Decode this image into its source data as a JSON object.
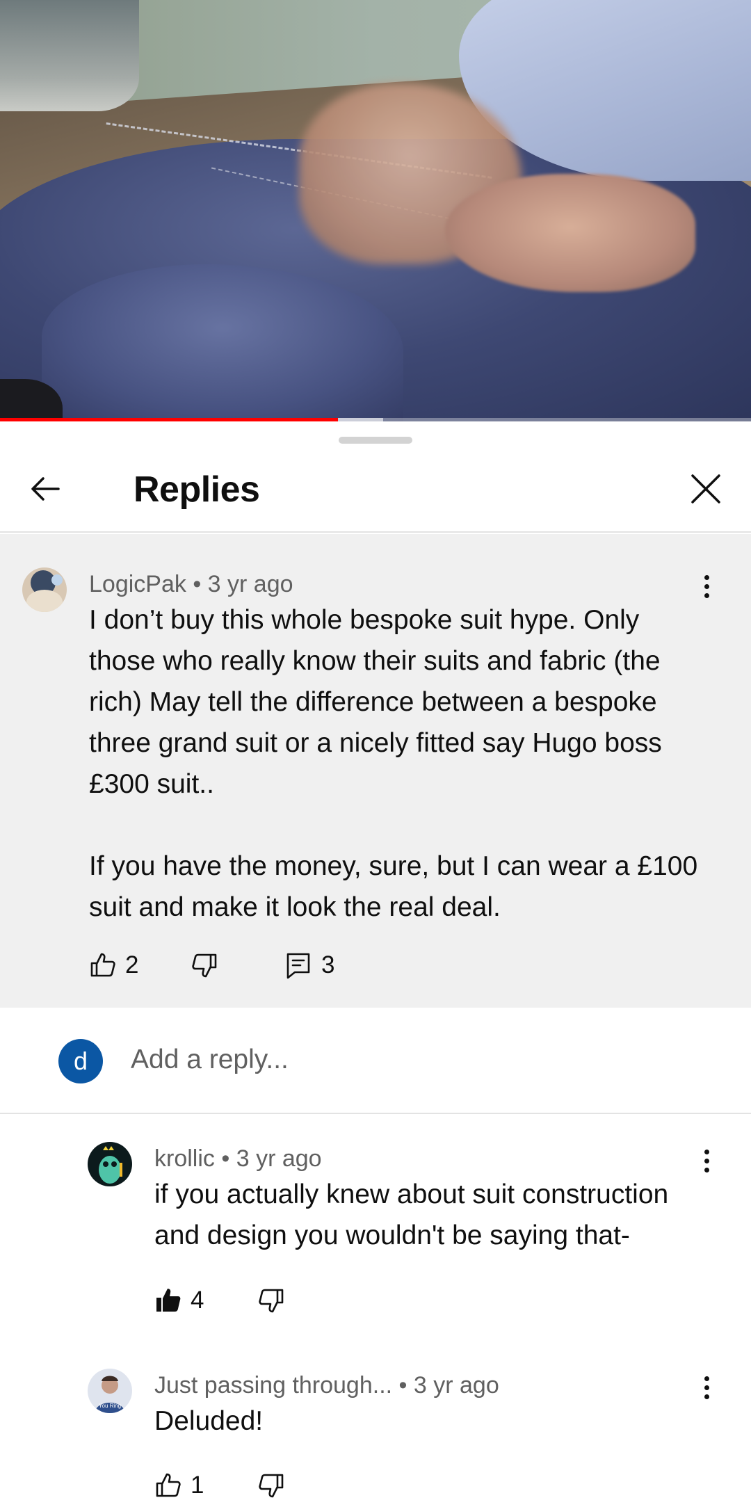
{
  "video": {
    "progress_fraction": 0.45,
    "buffered_fraction": 0.51,
    "colors": {
      "played": "#ff0000"
    }
  },
  "panel": {
    "title": "Replies",
    "back_icon": "arrow-left-icon",
    "close_icon": "close-icon"
  },
  "parent_comment": {
    "author": "LogicPak",
    "time": "• 3 yr ago",
    "paragraph1": "I don’t buy this whole bespoke suit hype. Only those who really know their suits and fabric (the rich) May tell the difference between a bespoke three grand suit or a nicely fitted say Hugo boss £300 suit..",
    "paragraph2": "If you have the money, sure, but I can wear a £100 suit and make it look the real deal.",
    "likes": "2",
    "replies": "3"
  },
  "reply_box": {
    "avatar_letter": "d",
    "placeholder": "Add a reply...",
    "avatar_color": "#0b57a4"
  },
  "replies": [
    {
      "author": "krollic",
      "time": "• 3 yr ago",
      "text": "if you actually knew about suit construction and design you wouldn't be saying that-",
      "likes": "4",
      "liked": true
    },
    {
      "author": "Just passing through...",
      "time": "• 3 yr ago",
      "text": "Deluded!",
      "likes": "1",
      "liked": false,
      "avatar_caption": "You Ring"
    }
  ]
}
